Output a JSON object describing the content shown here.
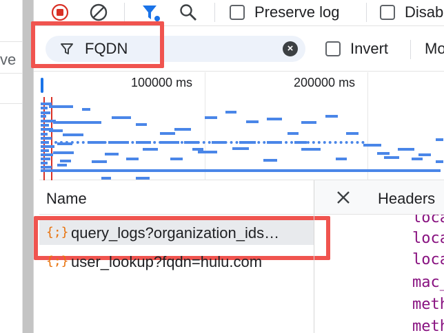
{
  "page_left": {
    "fragment": "ve"
  },
  "toolbar": {
    "preserve_log_label": "Preserve log",
    "disable_cache_label": "Disab"
  },
  "filter": {
    "value": "FQDN",
    "invert_label": "Invert",
    "more_label": "Mo"
  },
  "overview": {
    "ticks": [
      "100000 ms",
      "200000 ms"
    ]
  },
  "table": {
    "name_header": "Name",
    "rows": [
      {
        "icon": "{;}",
        "name": "query_logs?organization_ids…",
        "selected": true
      },
      {
        "icon": "{;}",
        "name": "user_lookup?fqdn=hulu.com",
        "selected": false
      }
    ]
  },
  "detail": {
    "headers_tab": "Headers",
    "code_lines": [
      "loca",
      "loca",
      "loca",
      "mac_",
      "meth",
      "meth"
    ]
  },
  "colors": {
    "highlight": "#f0544f",
    "accent_blue": "#1a73e8",
    "record_red": "#d93025",
    "json_icon": "#e8710a",
    "code_purple": "#881280"
  }
}
